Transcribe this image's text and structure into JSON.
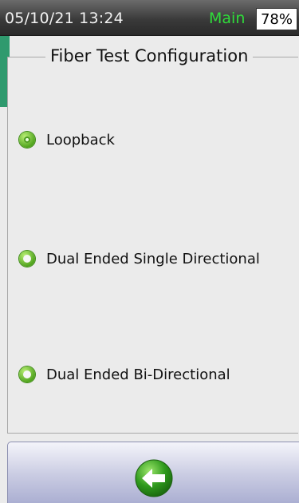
{
  "status_bar": {
    "datetime": "05/10/21 13:24",
    "mode": "Main",
    "battery": "78%"
  },
  "panel": {
    "title": "Fiber Test Configuration",
    "options": [
      {
        "label": "Loopback",
        "selected": true
      },
      {
        "label": "Dual Ended Single Directional",
        "selected": false
      },
      {
        "label": "Dual Ended Bi-Directional",
        "selected": false
      }
    ]
  },
  "footer": {
    "back_icon": "arrow-left-icon"
  },
  "colors": {
    "accent_green": "#52a51f",
    "mode_text": "#2fdc3a",
    "status_bar": "#3a3a3a",
    "footer_bar": "#c9cbe2"
  }
}
